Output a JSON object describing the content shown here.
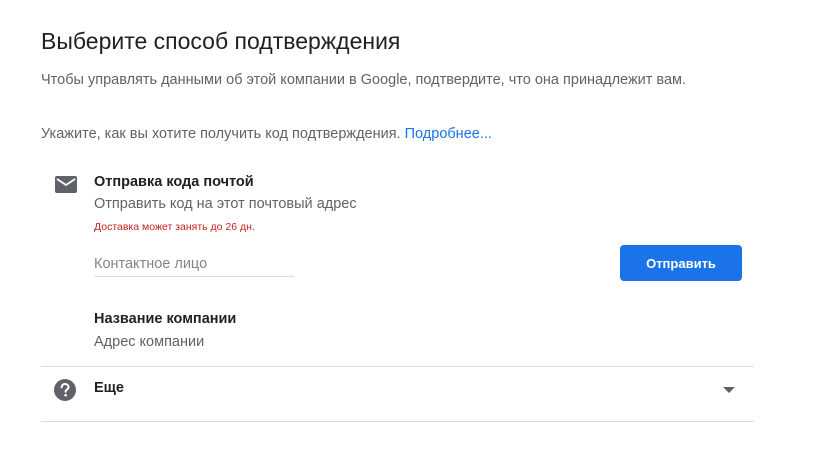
{
  "page": {
    "title": "Выберите способ подтверждения",
    "intro": "Чтобы управлять данными об этой компании в Google, подтвердите, что она принадлежит вам.",
    "hint": "Укажите, как вы хотите получить код подтверждения.",
    "learn_more": "Подробнее..."
  },
  "mail_option": {
    "icon": "mail-icon",
    "title": "Отправка кода почтой",
    "subtitle": "Отправить код на этот почтовый адрес",
    "warning": "Доставка может занять до 26 дн.",
    "contact_placeholder": "Контактное лицо",
    "contact_value": "",
    "send_label": "Отправить",
    "company_name": "Название компании",
    "company_address": "Адрес компании"
  },
  "more": {
    "icon": "help-icon",
    "label": "Еще",
    "chevron_icon": "chevron-down-icon"
  },
  "colors": {
    "accent": "#1a73e8",
    "warning": "#c5221f",
    "text_primary": "#202124",
    "text_secondary": "#5f6368",
    "divider": "#dadce0",
    "icon": "#5f6368"
  }
}
